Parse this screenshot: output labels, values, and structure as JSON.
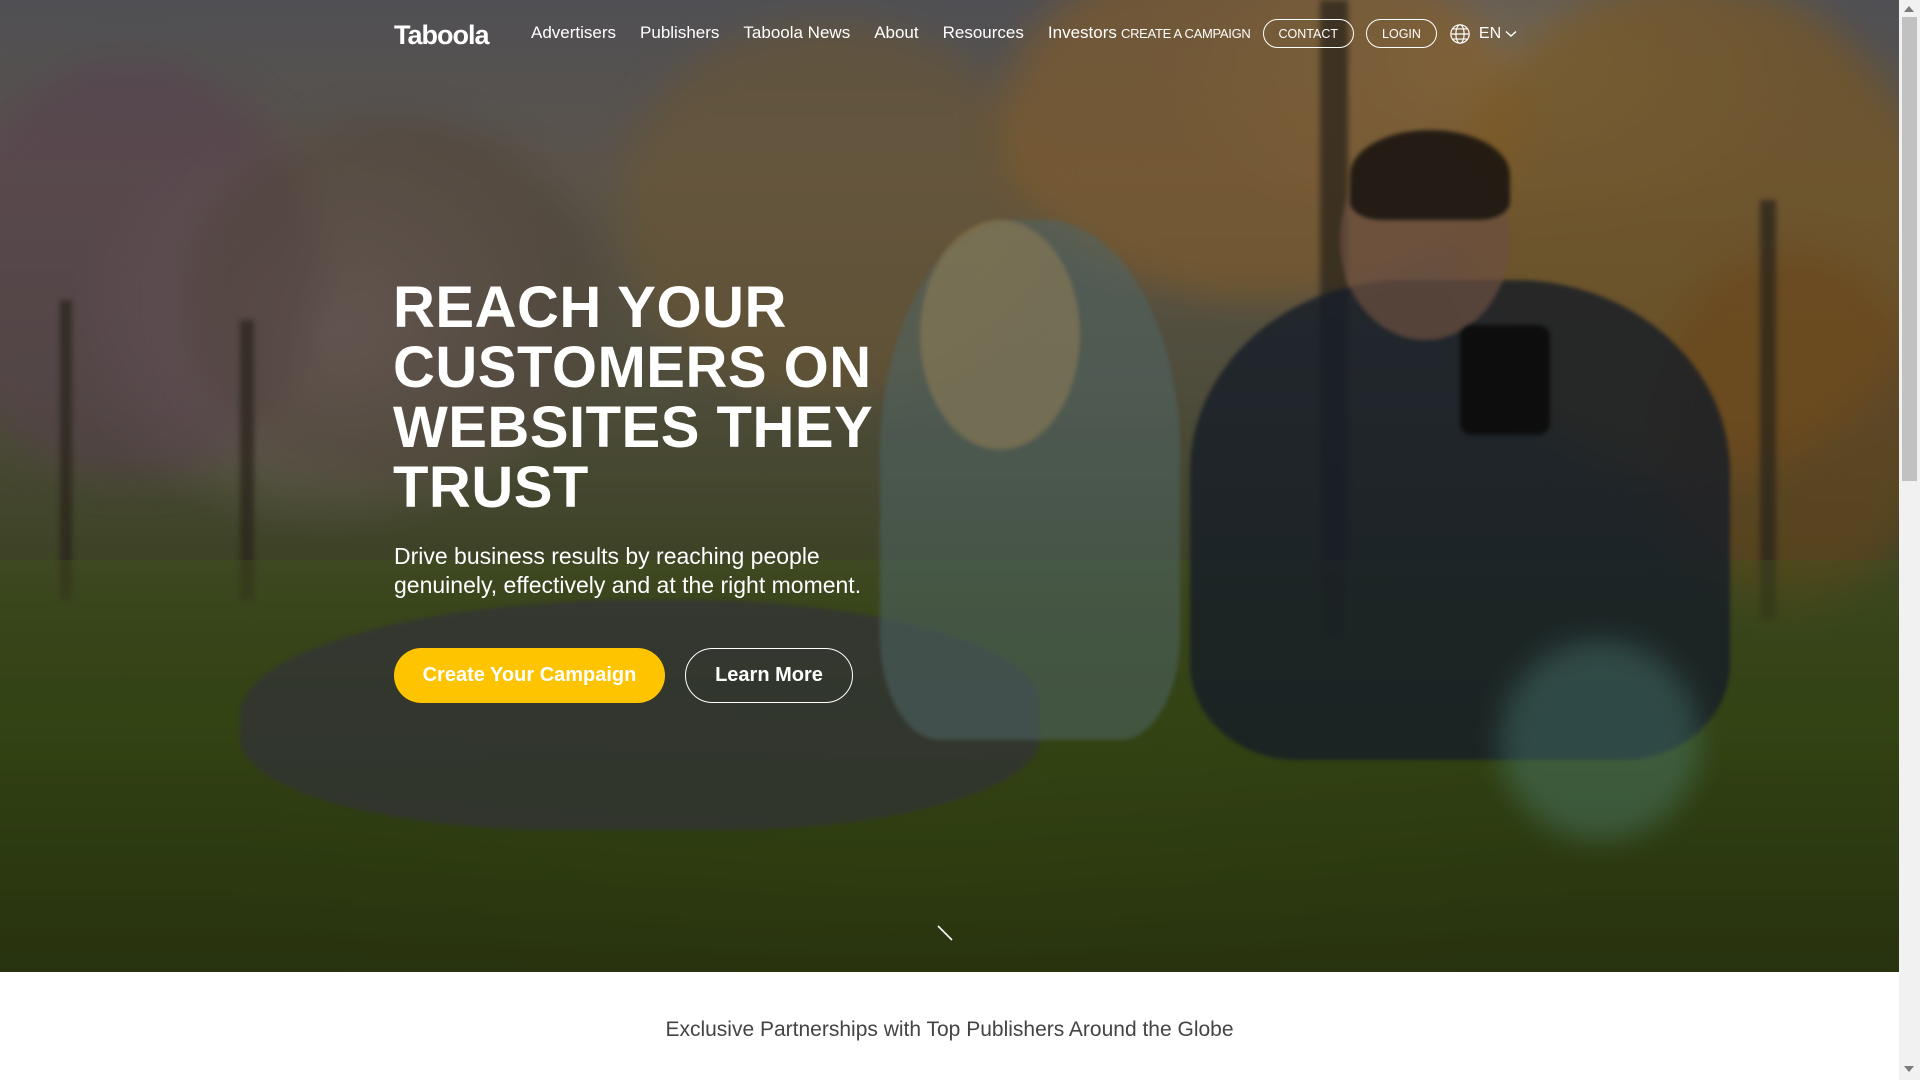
{
  "nav": {
    "logo": "Taboola",
    "links": [
      "Advertisers",
      "Publishers",
      "Taboola News",
      "About",
      "Resources",
      "Investors"
    ],
    "create_campaign": "CREATE A CAMPAIGN",
    "contact": "CONTACT",
    "login": "LOGIN",
    "language": "EN"
  },
  "hero": {
    "headline": "REACH YOUR CUSTOMERS ON WEBSITES THEY TRUST",
    "subline": "Drive business results by reaching people genuinely, effectively and at the right moment.",
    "primary_button": "Create Your Campaign",
    "secondary_button": "Learn More"
  },
  "partners_heading": "Exclusive Partnerships with Top Publishers Around the Globe",
  "colors": {
    "accent": "#ffc400",
    "text_light": "#ffffff",
    "text_dark": "#444444"
  },
  "icons": [
    "globe-icon",
    "chevron-down-icon",
    "scroll-down-icon"
  ]
}
